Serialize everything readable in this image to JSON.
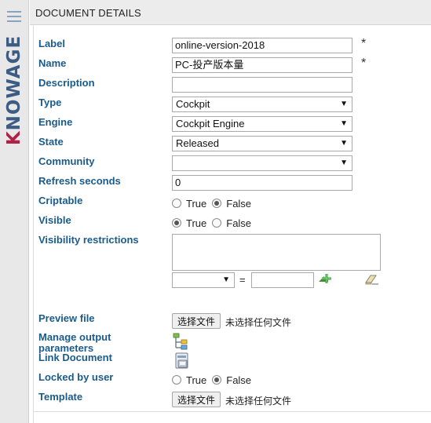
{
  "brand": {
    "logo_text": "KNOWAGE"
  },
  "header": {
    "title": "DOCUMENT DETAILS"
  },
  "fields": {
    "label": {
      "label": "Label",
      "value": "online-version-2018",
      "required": "*"
    },
    "name": {
      "label": "Name",
      "value": "PC-投产版本量",
      "required": "*"
    },
    "description": {
      "label": "Description",
      "value": ""
    },
    "type": {
      "label": "Type",
      "value": "Cockpit"
    },
    "engine": {
      "label": "Engine",
      "value": "Cockpit Engine"
    },
    "state": {
      "label": "State",
      "value": "Released"
    },
    "community": {
      "label": "Community",
      "value": ""
    },
    "refresh": {
      "label": "Refresh seconds",
      "value": "0"
    },
    "criptable": {
      "label": "Criptable",
      "true_label": "True",
      "false_label": "False",
      "selected": "False"
    },
    "visible": {
      "label": "Visible",
      "true_label": "True",
      "false_label": "False",
      "selected": "True"
    },
    "visibility": {
      "label": "Visibility restrictions",
      "equals": "="
    },
    "preview": {
      "label": "Preview file",
      "button": "选择文件",
      "status": "未选择任何文件"
    },
    "manage_output": {
      "label": "Manage output parameters"
    },
    "link_document": {
      "label": "Link Document"
    },
    "locked": {
      "label": "Locked by user",
      "true_label": "True",
      "false_label": "False",
      "selected": "False"
    },
    "template": {
      "label": "Template",
      "button": "选择文件",
      "status": "未选择任何文件"
    }
  },
  "dropdown_glyph": "▼",
  "icons": [
    "menu-icon",
    "tree-structure-icon",
    "document-link-icon",
    "add-arrow-icon",
    "eraser-icon"
  ]
}
